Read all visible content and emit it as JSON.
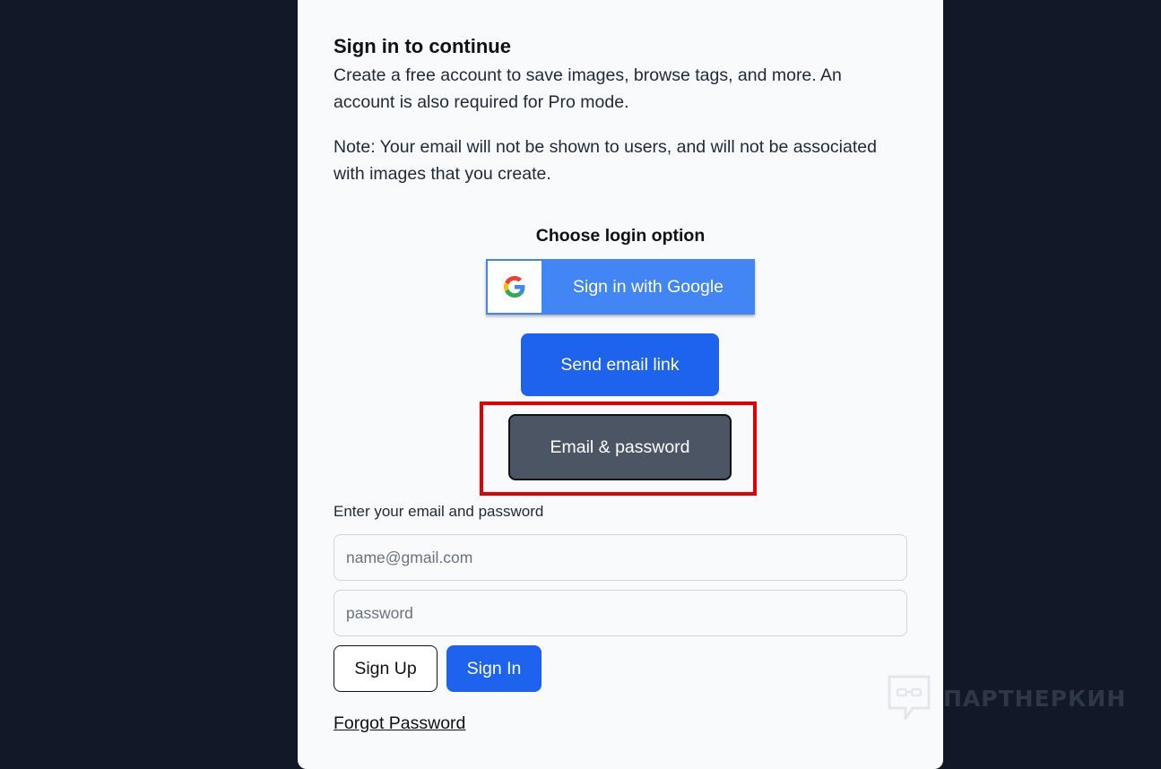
{
  "modal": {
    "title": "Sign in to continue",
    "description": "Create a free account to save images, browse tags, and more. An account is also required for Pro mode.",
    "note": "Note: Your email will not be shown to users, and will not be associated with images that you create."
  },
  "login_options": {
    "heading": "Choose login option",
    "google_label": "Sign in with Google",
    "email_link_label": "Send email link",
    "email_password_label": "Email & password"
  },
  "email_form": {
    "label": "Enter your email and password",
    "email_placeholder": "name@gmail.com",
    "password_placeholder": "password",
    "signup_label": "Sign Up",
    "signin_label": "Sign In",
    "forgot_label": "Forgot Password"
  },
  "watermark": {
    "text": "ПАРТНЕРКИН"
  },
  "colors": {
    "background": "#111827",
    "modal": "#f9fafb",
    "primary_blue": "#1d63ed",
    "google_blue": "#4285f4",
    "secondary_gray": "#4b5563",
    "highlight_red": "#e00000"
  },
  "icons": {
    "google": "google-g-icon",
    "watermark_logo": "chat-bubble-glasses-icon"
  }
}
